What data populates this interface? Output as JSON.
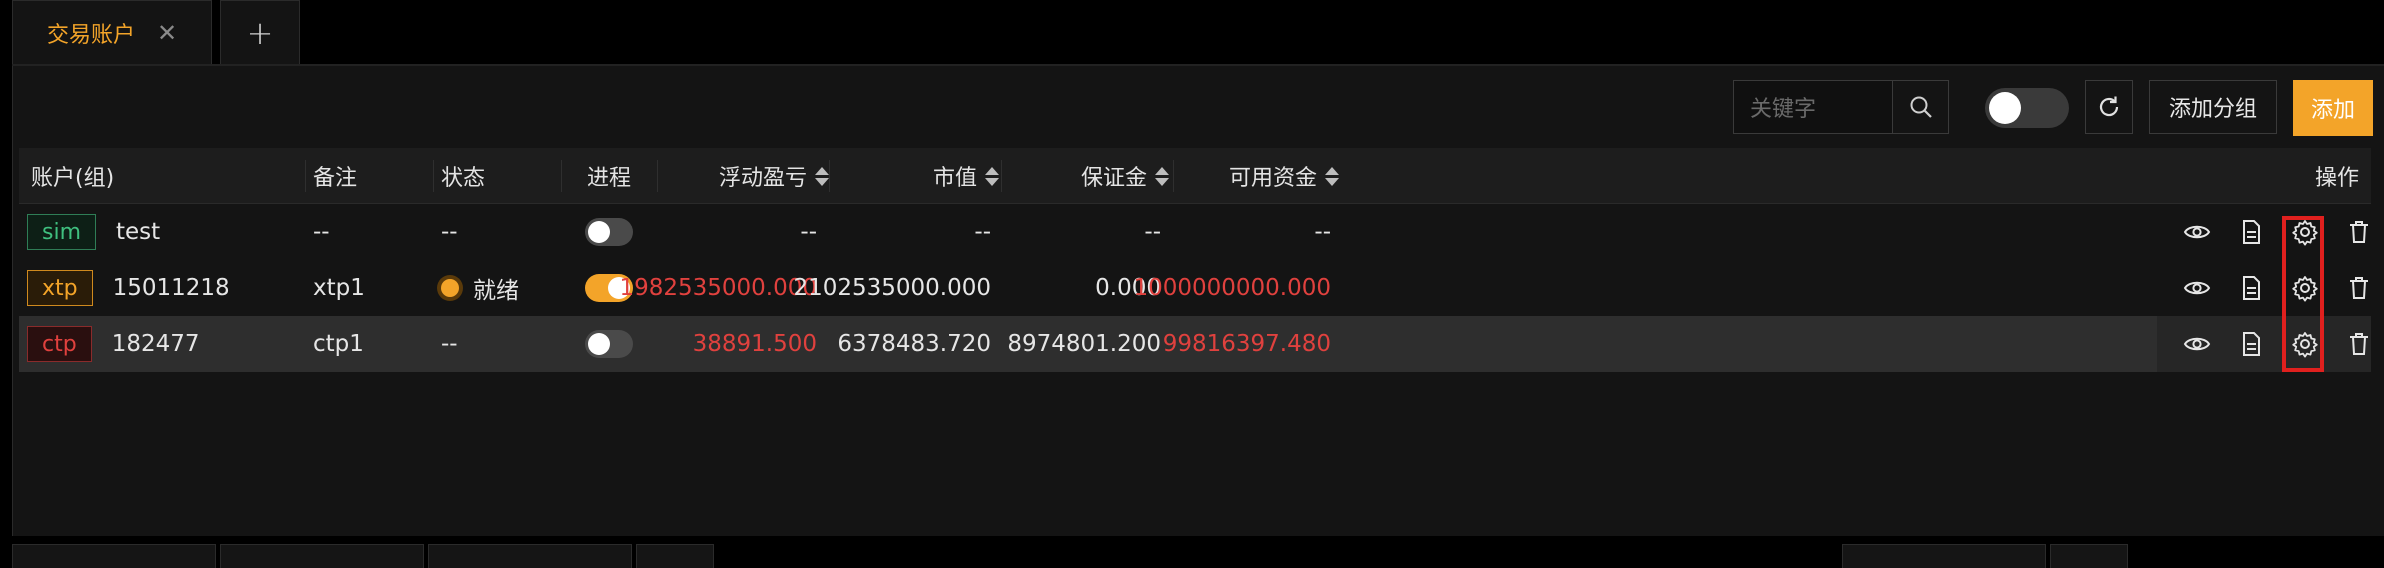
{
  "tabs": [
    {
      "label": "交易账户",
      "close_icon": "close-icon",
      "active": true
    }
  ],
  "add_tab_symbol": "+",
  "toolbar": {
    "search_placeholder": "关键字",
    "search_icon": "search-icon",
    "toggle_state": "off",
    "refresh_icon": "refresh-icon",
    "add_group_label": "添加分组",
    "add_label": "添加"
  },
  "table": {
    "headers": {
      "account": "账户(组)",
      "remark": "备注",
      "status": "状态",
      "process": "进程",
      "float_pnl": "浮动盈亏",
      "market_value": "市值",
      "margin": "保证金",
      "available": "可用资金",
      "actions": "操作"
    },
    "rows": [
      {
        "type": "sim",
        "account": "test",
        "remark": "--",
        "status": "--",
        "process_on": false,
        "float_pnl": "--",
        "market_value": "--",
        "margin": "--",
        "available": "--"
      },
      {
        "type": "xtp",
        "account": "15011218",
        "remark": "xtp1",
        "status": "就绪",
        "process_on": true,
        "float_pnl": "1982535000.000",
        "market_value": "2102535000.000",
        "margin": "0.000",
        "available": "1000000000.000"
      },
      {
        "type": "ctp",
        "account": "182477",
        "remark": "ctp1",
        "status": "--",
        "process_on": false,
        "float_pnl": "38891.500",
        "market_value": "6378483.720",
        "margin": "8974801.200",
        "available": "99816397.480"
      }
    ],
    "action_icons": [
      "eye-icon",
      "document-icon",
      "gear-icon",
      "trash-icon"
    ]
  },
  "colors": {
    "accent": "#f3a429",
    "negative": "#e0413e",
    "highlight": "#e0201e",
    "sim": "#3fbf7f"
  }
}
